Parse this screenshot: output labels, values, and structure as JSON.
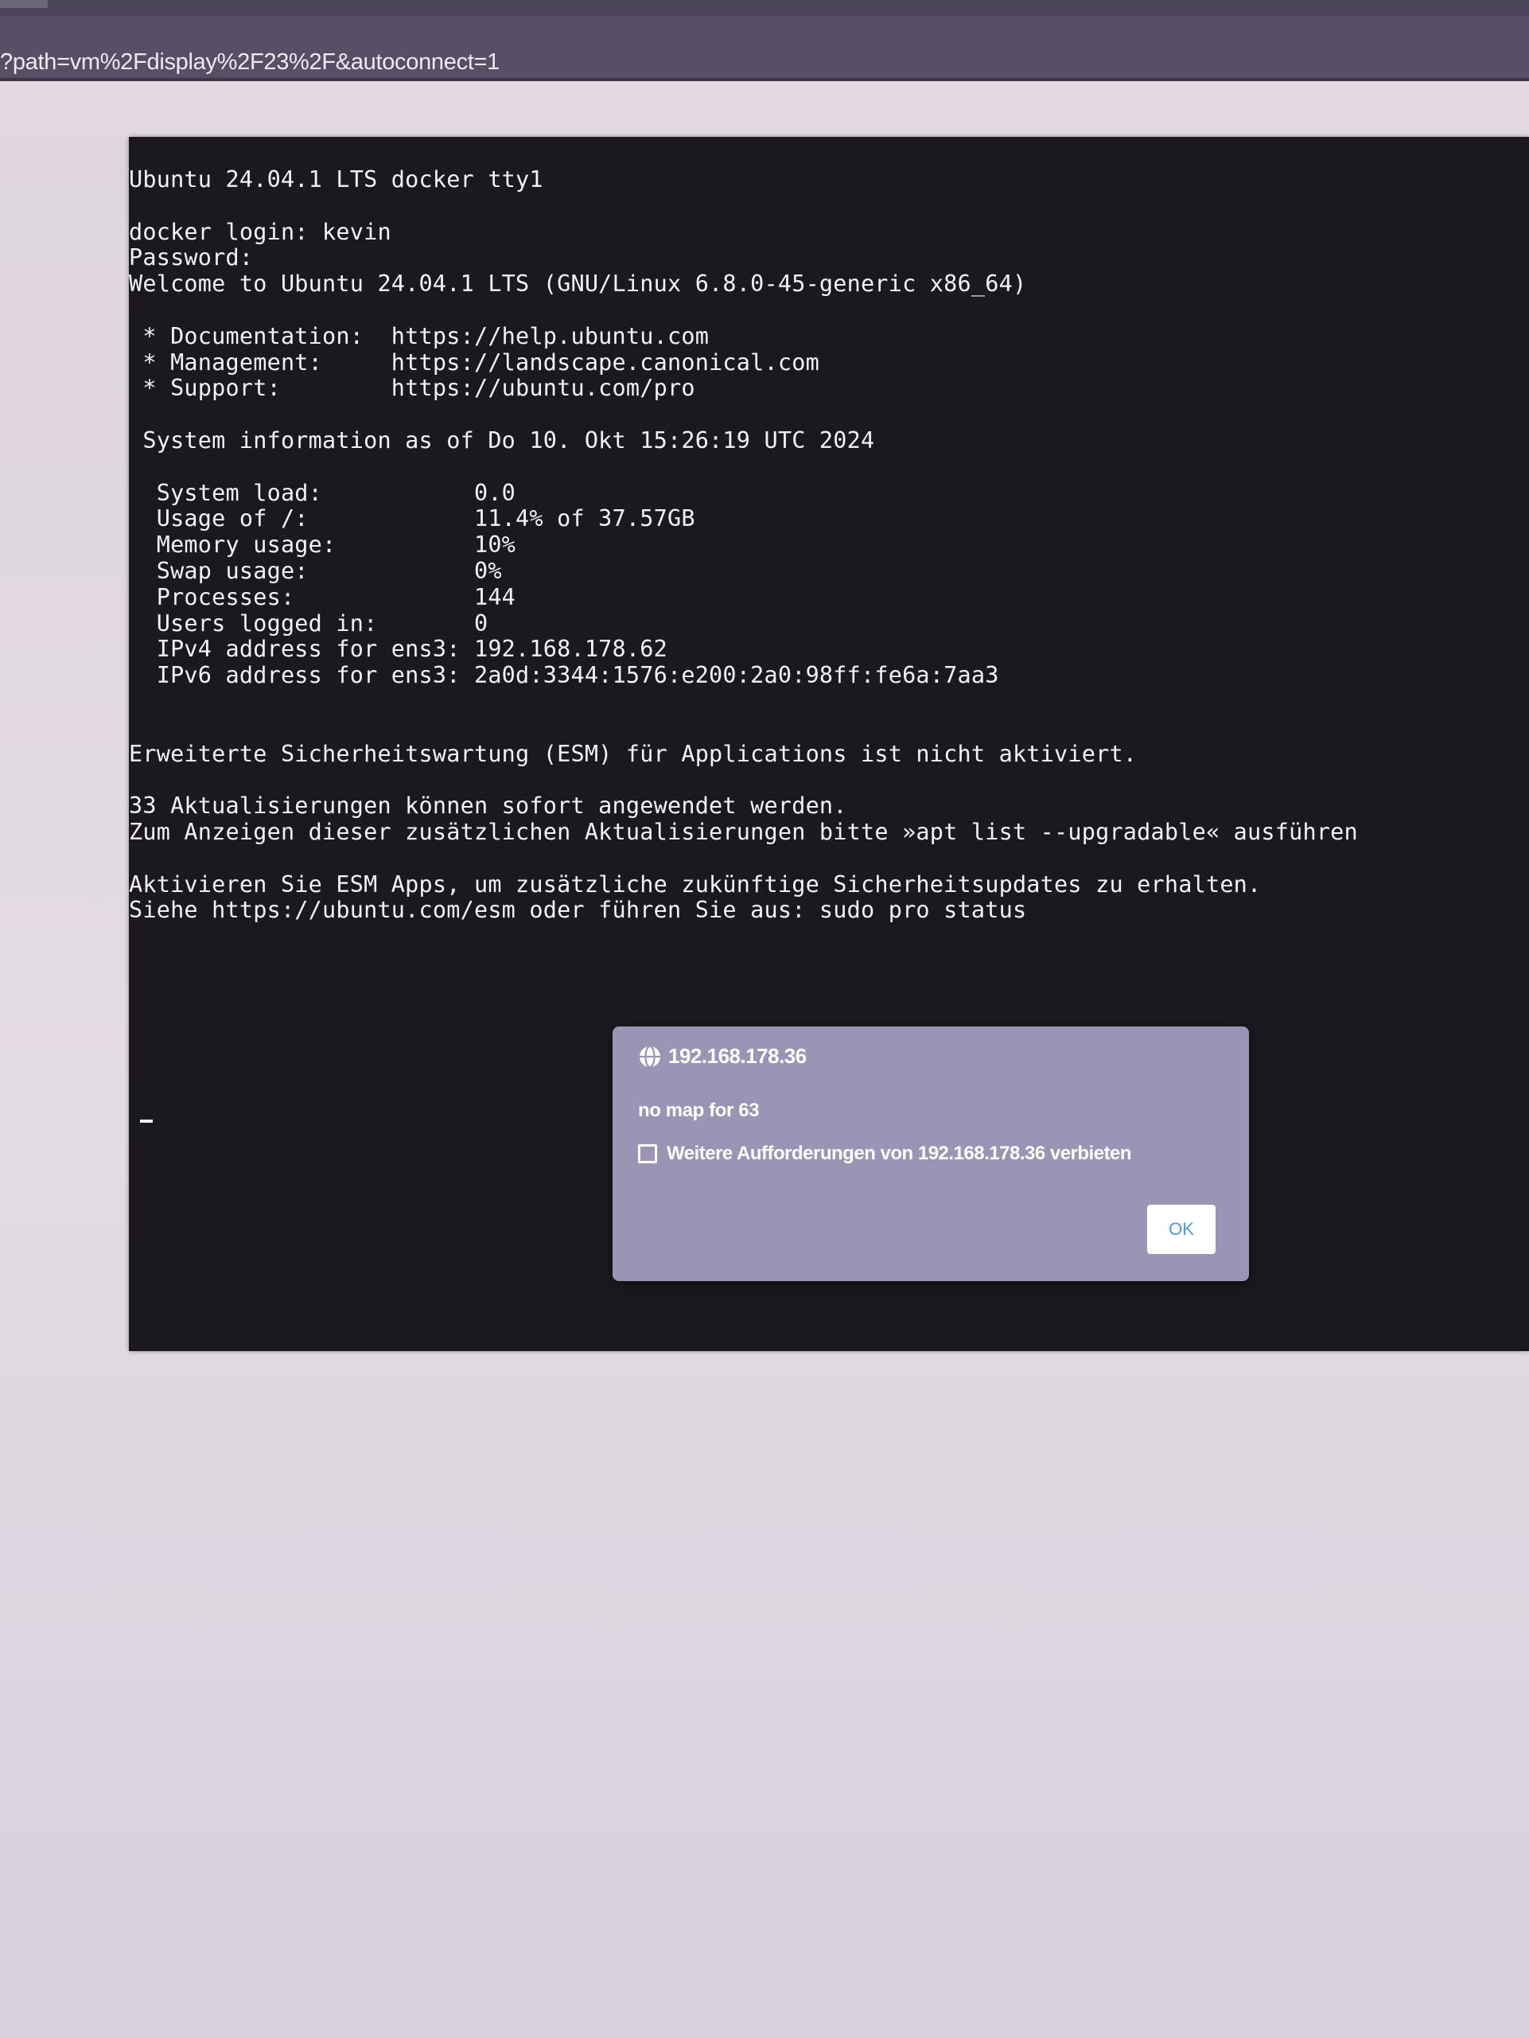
{
  "browser": {
    "url": "?path=vm%2Fdisplay%2F23%2F&autoconnect=1"
  },
  "terminal": {
    "lines": [
      "Ubuntu 24.04.1 LTS docker tty1",
      "",
      "docker login: kevin",
      "Password:",
      "Welcome to Ubuntu 24.04.1 LTS (GNU/Linux 6.8.0-45-generic x86_64)",
      "",
      " * Documentation:  https://help.ubuntu.com",
      " * Management:     https://landscape.canonical.com",
      " * Support:        https://ubuntu.com/pro",
      "",
      " System information as of Do 10. Okt 15:26:19 UTC 2024",
      "",
      "  System load:           0.0",
      "  Usage of /:            11.4% of 37.57GB",
      "  Memory usage:          10%",
      "  Swap usage:            0%",
      "  Processes:             144",
      "  Users logged in:       0",
      "  IPv4 address for ens3: 192.168.178.62",
      "  IPv6 address for ens3: 2a0d:3344:1576:e200:2a0:98ff:fe6a:7aa3",
      "",
      "",
      "Erweiterte Sicherheitswartung (ESM) für Applications ist nicht aktiviert.",
      "",
      "33 Aktualisierungen können sofort angewendet werden.",
      "Zum Anzeigen dieser zusätzlichen Aktualisierungen bitte »apt list --upgradable« ausführen",
      "",
      "Aktivieren Sie ESM Apps, um zusätzliche zukünftige Sicherheitsupdates zu erhalten.",
      "Siehe https://ubuntu.com/esm oder führen Sie aus: sudo pro status"
    ]
  },
  "dialog": {
    "title": "192.168.178.36",
    "icon": "globe-icon",
    "message": "no map for 63",
    "checkbox_label": "Weitere Aufforderungen von 192.168.178.36 verbieten",
    "checkbox_checked": false,
    "ok_label": "OK"
  }
}
